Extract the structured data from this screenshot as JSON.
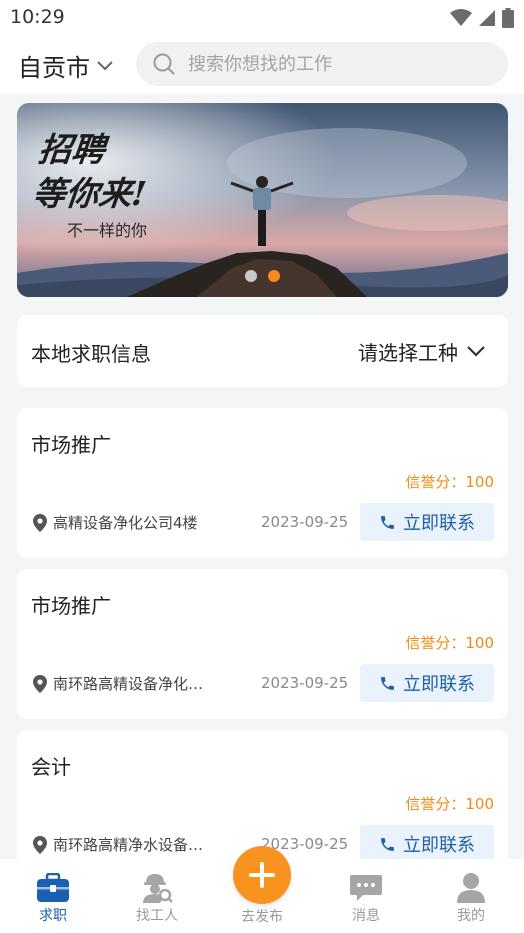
{
  "status_bar": {
    "time": "10:29"
  },
  "header": {
    "city": "自贡市",
    "search_placeholder": "搜索你想找的工作"
  },
  "banner": {
    "slogan_line1": "招聘",
    "slogan_line2": "等你来!",
    "slogan_line3": "不一样的你",
    "slide_count": 2,
    "active_slide": 2
  },
  "filter": {
    "title": "本地求职信息",
    "picker_label": "请选择工种"
  },
  "jobs": [
    {
      "title": "市场推广",
      "credit": "信誉分：100",
      "location": "高精设备净化公司4楼",
      "date": "2023-09-25",
      "contact_label": "立即联系"
    },
    {
      "title": "市场推广",
      "credit": "信誉分：100",
      "location": "南环路高精设备净化…",
      "date": "2023-09-25",
      "contact_label": "立即联系"
    },
    {
      "title": "会计",
      "credit": "信誉分：100",
      "location": "南环路高精净水设备…",
      "date": "2023-09-25",
      "contact_label": "立即联系"
    }
  ],
  "tabbar": {
    "items": [
      {
        "label": "求职",
        "icon": "briefcase-icon",
        "active": true
      },
      {
        "label": "找工人",
        "icon": "worker-search-icon",
        "active": false
      },
      {
        "label": "去发布",
        "icon": "plus-icon",
        "active": false
      },
      {
        "label": "消息",
        "icon": "chat-icon",
        "active": false
      },
      {
        "label": "我的",
        "icon": "user-icon",
        "active": false
      }
    ]
  },
  "colors": {
    "accent_orange": "#f7931e",
    "credit_orange": "#f08c16",
    "primary_blue": "#1a5fb0",
    "contact_bg": "#eaf3fc",
    "page_bg": "#f4f5f7"
  }
}
